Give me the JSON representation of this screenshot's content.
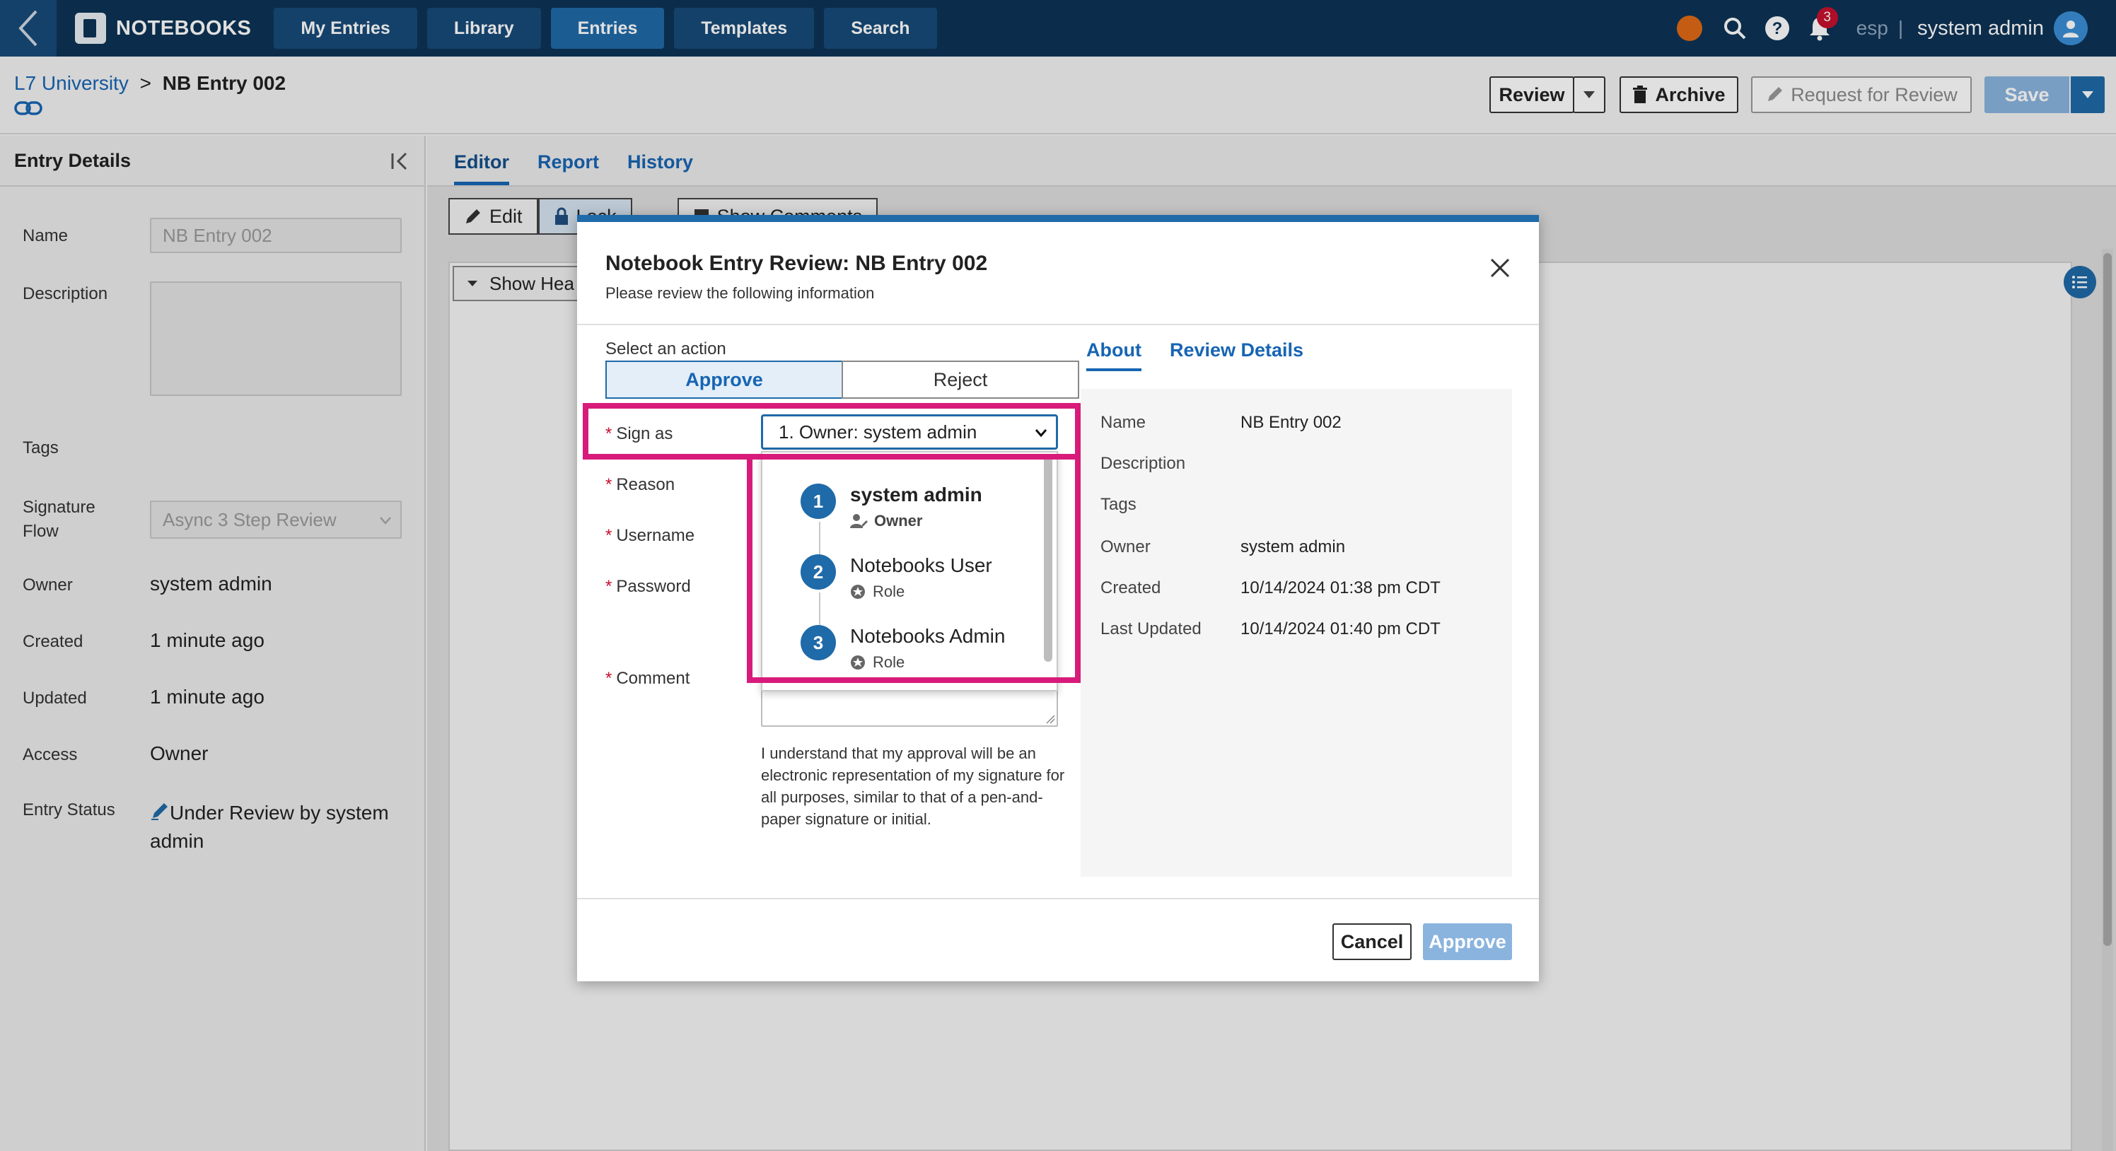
{
  "nav": {
    "brand": "NOTEBOOKS",
    "tabs": [
      "My Entries",
      "Library",
      "Entries",
      "Templates",
      "Search"
    ],
    "active_tab": "Entries",
    "notification_count": "3",
    "language": "esp",
    "separator": "|",
    "user": "system admin",
    "colors": {
      "nav_bg": "#0d3456",
      "tab_bg": "#174a78",
      "tab_active": "#1f6aa8",
      "status_dot": "#e06a16",
      "badge": "#c8102e"
    }
  },
  "header": {
    "breadcrumb_link": "L7 University",
    "breadcrumb_sep": ">",
    "breadcrumb_current": "NB Entry 002",
    "buttons": {
      "review": "Review",
      "archive": "Archive",
      "request_review": "Request for Review",
      "save": "Save"
    }
  },
  "left_panel": {
    "title": "Entry Details",
    "fields": {
      "name_label": "Name",
      "name_value": "NB Entry 002",
      "description_label": "Description",
      "tags_label": "Tags",
      "signature_flow_label_1": "Signature",
      "signature_flow_label_2": "Flow",
      "signature_flow_value": "Async 3 Step Review",
      "owner_label": "Owner",
      "owner_value": "system admin",
      "created_label": "Created",
      "created_value": "1 minute ago",
      "updated_label": "Updated",
      "updated_value": "1 minute ago",
      "access_label": "Access",
      "access_value": "Owner",
      "status_label": "Entry Status",
      "status_value_1": "Under Review by system",
      "status_value_2": "admin"
    }
  },
  "main": {
    "tabs": [
      "Editor",
      "Report",
      "History"
    ],
    "active_tab": "Editor",
    "toolbar": {
      "edit": "Edit",
      "lock": "Lock",
      "show_comments": "Show Comments"
    },
    "show_header": "Show Hea"
  },
  "modal": {
    "title": "Notebook Entry Review: NB Entry 002",
    "subtitle": "Please review the following information",
    "select_action_label": "Select an action",
    "approve_seg": "Approve",
    "reject_seg": "Reject",
    "labels": {
      "sign_as": "Sign as",
      "reason": "Reason",
      "username": "Username",
      "password": "Password",
      "comment": "Comment"
    },
    "required_mark": "*",
    "sign_as_value": "1. Owner: system admin",
    "dropdown": [
      {
        "num": "1",
        "name": "system admin",
        "sub": "Owner"
      },
      {
        "num": "2",
        "name": "Notebooks User",
        "sub": "Role"
      },
      {
        "num": "3",
        "name": "Notebooks Admin",
        "sub": "Role"
      }
    ],
    "disclaimer": "I understand that my approval will be an electronic representation of my signature for all purposes, similar to that of a pen-and-paper signature or initial.",
    "right_tabs": [
      "About",
      "Review Details"
    ],
    "about": {
      "name_label": "Name",
      "name_value": "NB Entry 002",
      "description_label": "Description",
      "tags_label": "Tags",
      "owner_label": "Owner",
      "owner_value": "system admin",
      "created_label": "Created",
      "created_value": "10/14/2024 01:38 pm CDT",
      "updated_label": "Last Updated",
      "updated_value": "10/14/2024 01:40 pm CDT"
    },
    "cancel": "Cancel",
    "approve": "Approve",
    "highlight_color": "#d81b7a"
  }
}
